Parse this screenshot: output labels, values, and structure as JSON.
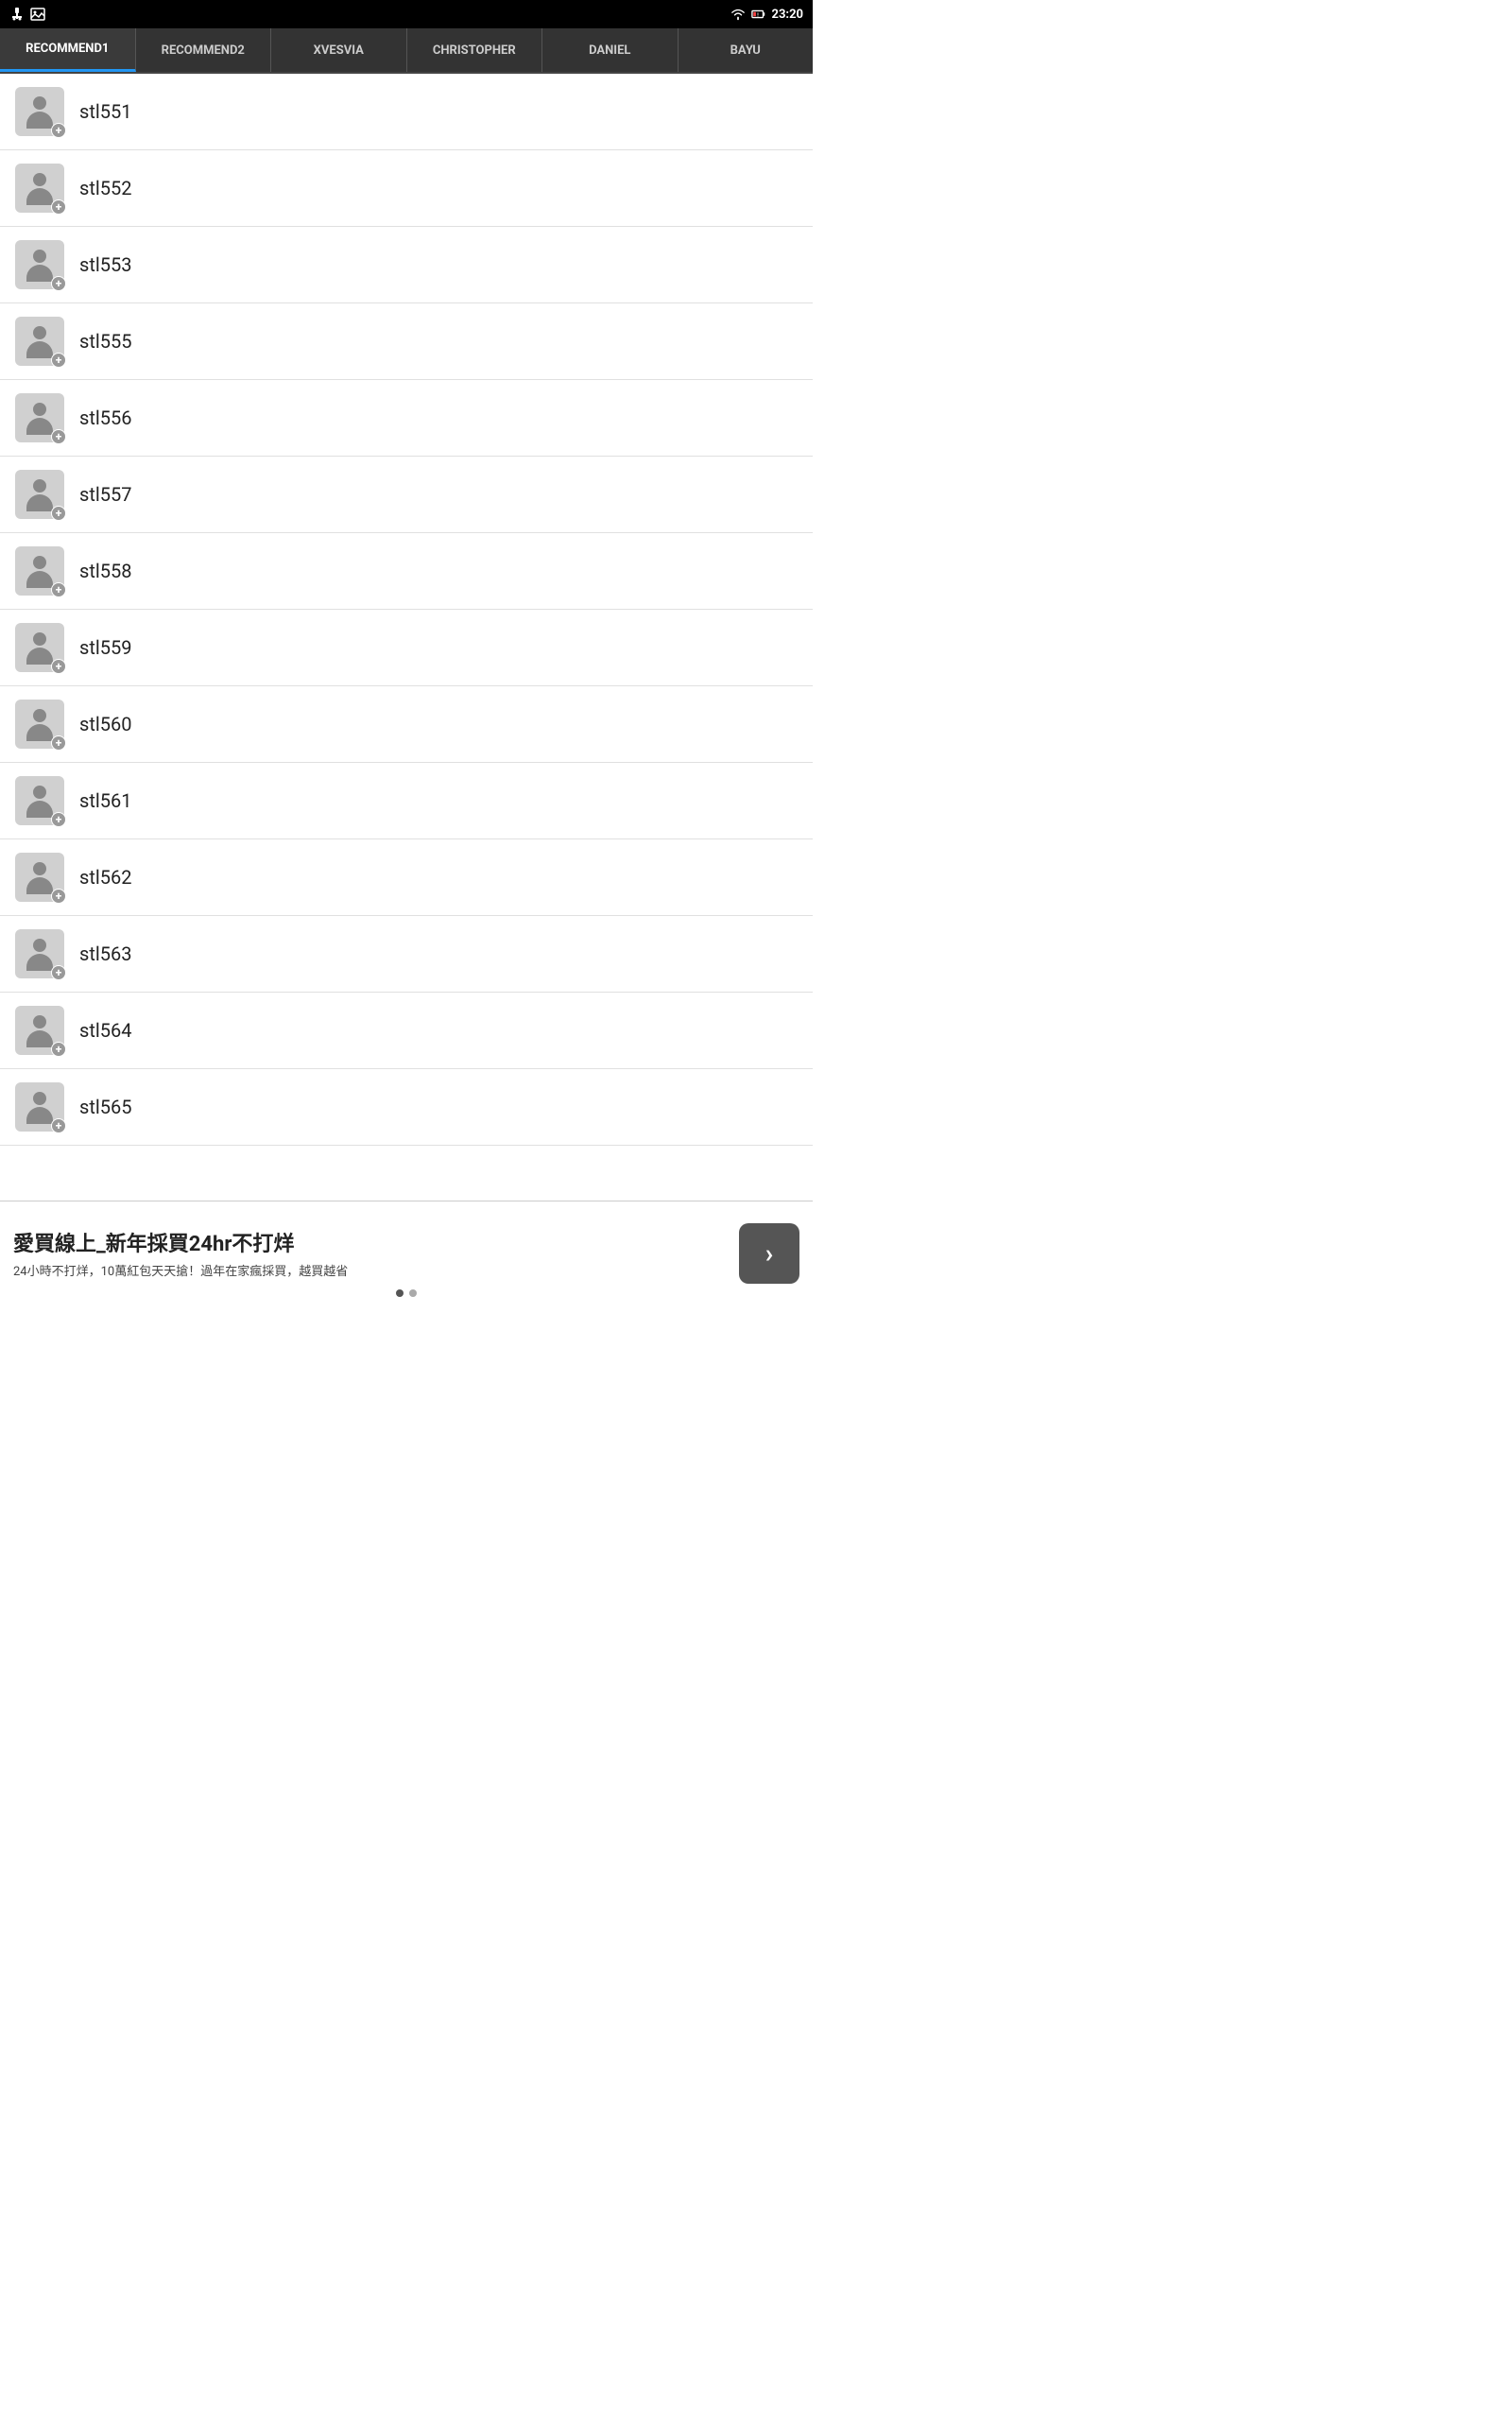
{
  "statusBar": {
    "time": "23:20",
    "icons": {
      "usb": "USB",
      "image": "IMG",
      "wifi": "WiFi",
      "battery": "BAT"
    }
  },
  "tabs": [
    {
      "id": "recommend1",
      "label": "RECOMMEND1",
      "active": true
    },
    {
      "id": "recommend2",
      "label": "RECOMMEND2",
      "active": false
    },
    {
      "id": "xvesvia",
      "label": "XVESVIA",
      "active": false
    },
    {
      "id": "christopher",
      "label": "CHRISTOPHER",
      "active": false
    },
    {
      "id": "daniel",
      "label": "DANIEL",
      "active": false
    },
    {
      "id": "bayu",
      "label": "BAYU",
      "active": false
    }
  ],
  "users": [
    {
      "id": 1,
      "name": "stl551"
    },
    {
      "id": 2,
      "name": "stl552"
    },
    {
      "id": 3,
      "name": "stl553"
    },
    {
      "id": 4,
      "name": "stl555"
    },
    {
      "id": 5,
      "name": "stl556"
    },
    {
      "id": 6,
      "name": "stl557"
    },
    {
      "id": 7,
      "name": "stl558"
    },
    {
      "id": 8,
      "name": "stl559"
    },
    {
      "id": 9,
      "name": "stl560"
    },
    {
      "id": 10,
      "name": "stl561"
    },
    {
      "id": 11,
      "name": "stl562"
    },
    {
      "id": 12,
      "name": "stl563"
    },
    {
      "id": 13,
      "name": "stl564"
    },
    {
      "id": 14,
      "name": "stl565"
    }
  ],
  "ad": {
    "title": "愛買線上_新年採買24hr不打烊",
    "subtitle": "24小時不打烊，10萬紅包天天搶！過年在家瘋採買，越買越省",
    "arrow_label": "›",
    "dots": [
      true,
      false
    ]
  }
}
